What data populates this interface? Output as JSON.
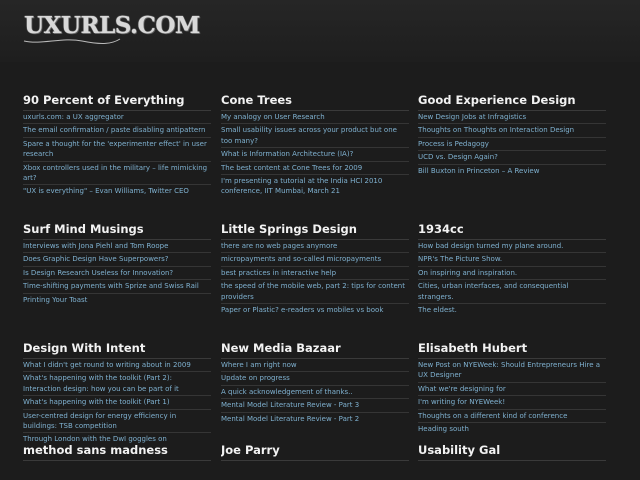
{
  "site": {
    "logo": "UXURLS.COM"
  },
  "columns": [
    {
      "title": "90 Percent of Everything",
      "items": [
        "uxurls.com: a UX aggregator",
        "The email confirmation / paste disabling antipattern",
        "Spare a thought for the 'experimenter effect' in user research",
        "Xbox controllers used in the military – life mimicking art?",
        "\"UX is everything\" – Evan Williams, Twitter CEO"
      ]
    },
    {
      "title": "Cone Trees",
      "items": [
        "My analogy on User Research",
        "Small usability issues across your product but one too many?",
        "What is Information Architecture (IA)?",
        "The best content at Cone Trees for 2009",
        "I'm presenting a tutorial at the India HCI 2010 conference, IIT Mumbai, March 21"
      ]
    },
    {
      "title": "Good Experience Design",
      "items": [
        "New Design Jobs at Infragistics",
        "Thoughts on Thoughts on Interaction Design",
        "Process is Pedagogy",
        "UCD vs. Design Again?",
        "Bill Buxton in Princeton – A Review"
      ]
    },
    {
      "title": "Surf Mind Musings",
      "items": [
        "Interviews with Jona Piehl and Tom Roope",
        "Does Graphic Design Have Superpowers?",
        "Is Design Research Useless for Innovation?",
        "Time-shifting payments with Sprize and Swiss Rail",
        "Printing Your Toast"
      ]
    },
    {
      "title": "Little Springs Design",
      "items": [
        "there are no web pages anymore",
        "micropayments and so-called micropayments",
        "best practices in interactive help",
        "the speed of the mobile web, part 2: tips for content providers",
        "Paper or Plastic? e-readers vs mobiles vs book"
      ]
    },
    {
      "title": "1934cc",
      "items": [
        "How bad design turned my plane around.",
        "NPR's The Picture Show.",
        "On inspiring and inspiration.",
        "Cities, urban interfaces, and consequential strangers.",
        "The eldest."
      ]
    },
    {
      "title": "Design With Intent",
      "items": [
        "What I didn't get round to writing about in 2009",
        "What's happening with the toolkit (Part 2): Interaction design: how you can be part of it",
        "What's happening with the toolkit (Part 1)",
        "User-centred design for energy efficiency in buildings: TSB competition",
        "Through London with the DwI goggles on"
      ]
    },
    {
      "title": "New Media Bazaar",
      "items": [
        "Where I am right now",
        "Update on progress",
        "A quick acknowledgement of thanks..",
        "Mental Model Literature Review - Part 3",
        "Mental Model Literature Review - Part 2"
      ]
    },
    {
      "title": "Elisabeth Hubert",
      "items": [
        "New Post on NYEWeek: Should Entrepreneurs Hire a UX Designer",
        "What we're designing for",
        "I'm writing for NYEWeek!",
        "Thoughts on a different kind of conference",
        "Heading south"
      ]
    },
    {
      "title": "method sans madness",
      "items": []
    },
    {
      "title": "Joe Parry",
      "items": []
    },
    {
      "title": "Usability Gal",
      "items": []
    }
  ]
}
